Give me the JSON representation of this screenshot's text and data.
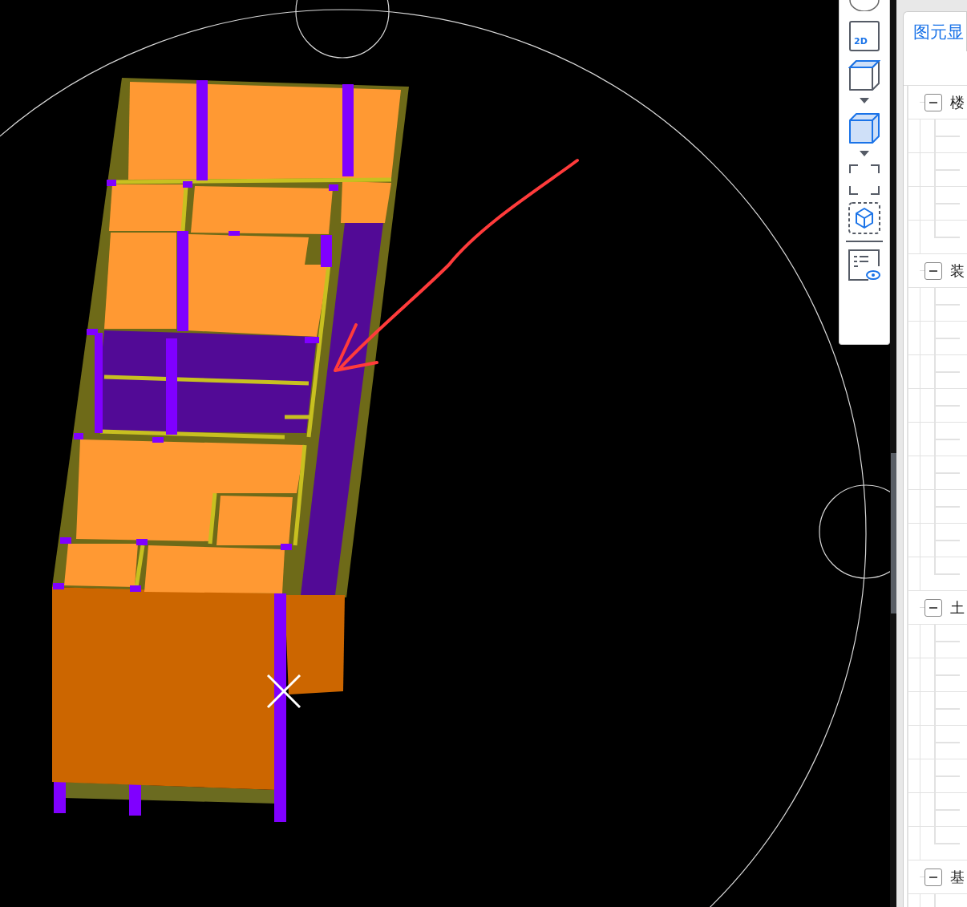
{
  "toolbar": {
    "buttons": [
      {
        "kind": "compass"
      },
      {
        "kind": "label",
        "label": "2D"
      },
      {
        "kind": "cube-outline"
      },
      {
        "kind": "caret"
      },
      {
        "kind": "cube-filled"
      },
      {
        "kind": "caret"
      },
      {
        "kind": "frame"
      },
      {
        "kind": "box-cube"
      },
      {
        "kind": "separator"
      },
      {
        "kind": "list-eye"
      }
    ]
  },
  "panel": {
    "tab": {
      "label": "图元显",
      "selected": true
    },
    "tree": [
      {
        "label": "楼",
        "expanded": true,
        "children": [
          {
            "kind": "blank"
          },
          {
            "kind": "blank"
          },
          {
            "kind": "blank"
          },
          {
            "kind": "blank"
          }
        ]
      },
      {
        "label": "装",
        "expanded": true,
        "children": [
          {
            "kind": "blank"
          },
          {
            "kind": "blank"
          },
          {
            "kind": "blank"
          },
          {
            "kind": "blank"
          },
          {
            "kind": "blank"
          },
          {
            "kind": "blank"
          },
          {
            "kind": "blank"
          },
          {
            "kind": "blank"
          },
          {
            "kind": "blank"
          }
        ]
      },
      {
        "label": "土",
        "expanded": true,
        "children": [
          {
            "kind": "blank"
          },
          {
            "kind": "blank"
          },
          {
            "kind": "blank"
          },
          {
            "kind": "blank"
          },
          {
            "kind": "blank"
          },
          {
            "kind": "blank"
          },
          {
            "kind": "blank"
          }
        ]
      },
      {
        "label": "基",
        "expanded": true,
        "children": [
          {
            "kind": "blank"
          }
        ]
      }
    ]
  }
}
